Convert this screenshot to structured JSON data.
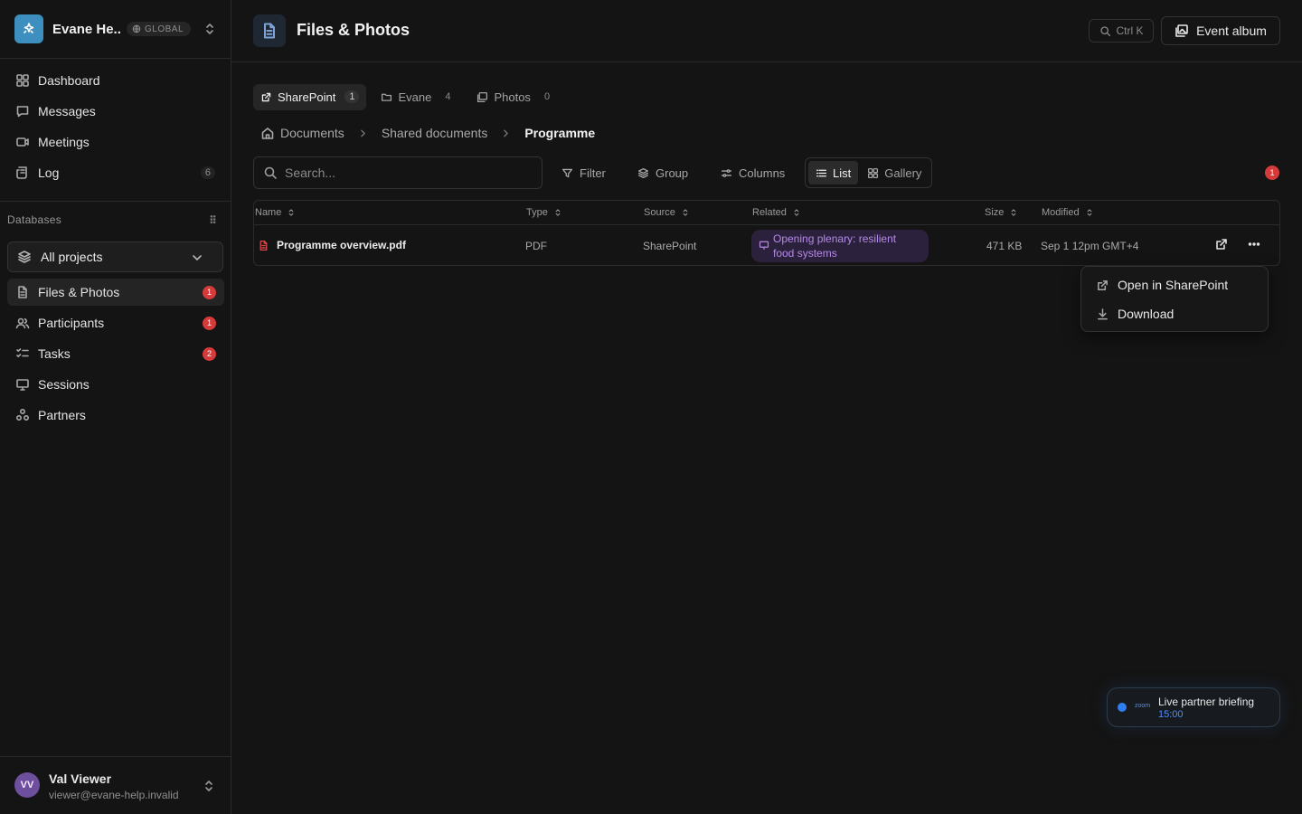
{
  "workspace": {
    "name": "Evane He...",
    "badge": "GLOBAL"
  },
  "nav_main": [
    {
      "label": "Dashboard"
    },
    {
      "label": "Messages"
    },
    {
      "label": "Meetings"
    },
    {
      "label": "Log",
      "count": "6"
    }
  ],
  "databases": {
    "label": "Databases",
    "project_select": "All projects",
    "items": [
      {
        "label": "Files & Photos",
        "badge": "1"
      },
      {
        "label": "Participants",
        "badge": "1"
      },
      {
        "label": "Tasks",
        "badge": "2"
      },
      {
        "label": "Sessions"
      },
      {
        "label": "Partners"
      }
    ]
  },
  "user": {
    "initials": "VV",
    "name": "Val Viewer",
    "email": "viewer@evane-help.invalid"
  },
  "header": {
    "title": "Files & Photos",
    "shortcut": "Ctrl K",
    "album_button": "Event album"
  },
  "source_tabs": [
    {
      "label": "SharePoint",
      "count": "1"
    },
    {
      "label": "Evane",
      "count": "4"
    },
    {
      "label": "Photos",
      "count": "0"
    }
  ],
  "breadcrumb": [
    "Documents",
    "Shared documents",
    "Programme"
  ],
  "toolbar": {
    "search_placeholder": "Search...",
    "filter": "Filter",
    "group": "Group",
    "columns": "Columns",
    "view_list": "List",
    "view_gallery": "Gallery",
    "notifications": "1"
  },
  "table": {
    "columns": [
      "Name",
      "Type",
      "Source",
      "Related",
      "Size",
      "Modified"
    ],
    "rows": [
      {
        "name": "Programme overview.pdf",
        "type": "PDF",
        "source": "SharePoint",
        "related_line1": "Opening plenary: resilient",
        "related_line2": "food systems",
        "size": "471 KB",
        "modified": "Sep 1 12pm GMT+4"
      }
    ]
  },
  "row_menu": {
    "open": "Open in SharePoint",
    "download": "Download"
  },
  "live": {
    "badge": "zoom",
    "title": "Live partner briefing",
    "time": "15:00"
  },
  "colors": {
    "accent": "#3d8fbf",
    "danger": "#d63b3b",
    "related": "#b58ae6",
    "live": "#2f7ff0"
  }
}
